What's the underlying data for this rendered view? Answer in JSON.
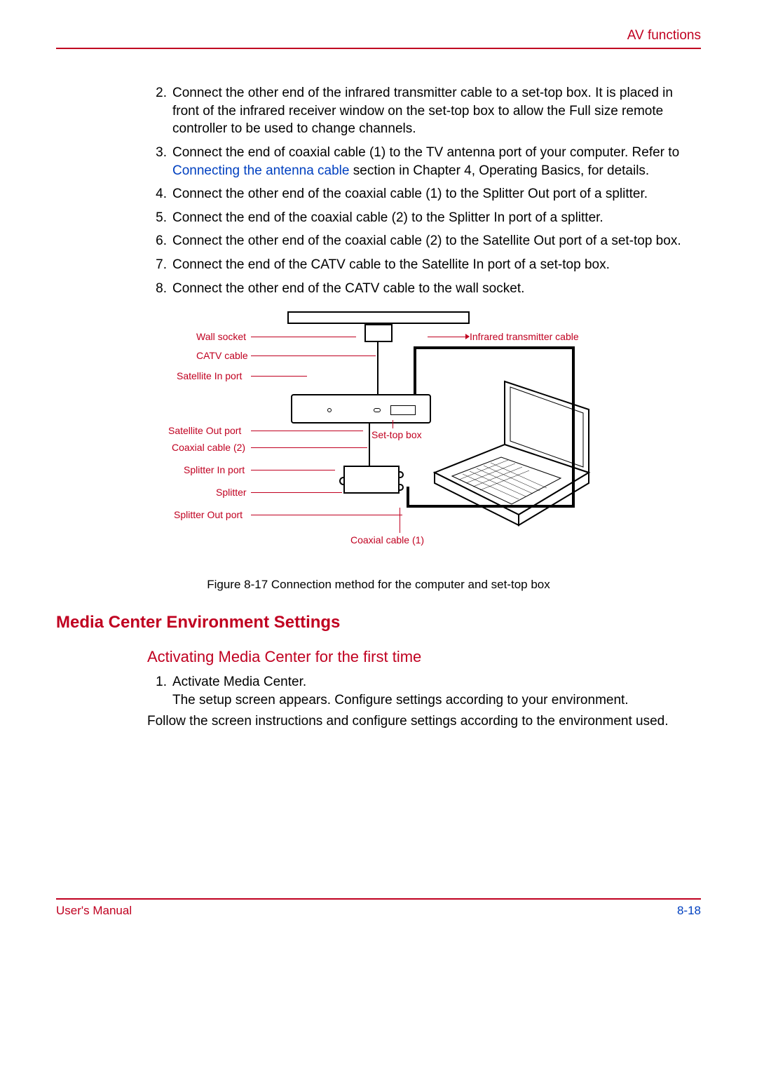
{
  "header": {
    "title": "AV functions"
  },
  "steps": [
    {
      "n": "2.",
      "text": "Connect the other end of the infrared transmitter cable to a set-top box. It is placed in front of the infrared receiver window on the set-top box to allow the Full size remote controller to be used to change channels."
    },
    {
      "n": "3.",
      "pre": "Connect the end of coaxial cable (1) to the TV antenna port of your computer. Refer to ",
      "link": "Connecting the antenna cable",
      "post": " section in Chapter 4, Operating Basics, for details."
    },
    {
      "n": "4.",
      "text": "Connect the other end of the coaxial cable (1) to the Splitter Out port of a splitter."
    },
    {
      "n": "5.",
      "text": "Connect the end of the coaxial cable (2) to the Splitter In port of a splitter."
    },
    {
      "n": "6.",
      "text": "Connect the other end of the coaxial cable (2) to the Satellite Out port of a set-top box."
    },
    {
      "n": "7.",
      "text": "Connect the end of the CATV cable to the Satellite In port of a set-top box."
    },
    {
      "n": "8.",
      "text": "Connect the other end of the CATV cable to the wall socket."
    }
  ],
  "labels": {
    "wall_socket": "Wall socket",
    "catv_cable": "CATV cable",
    "sat_in": "Satellite In port",
    "sat_out": "Satellite Out port",
    "coax2": "Coaxial cable (2)",
    "splitter_in": "Splitter In port",
    "splitter": "Splitter",
    "splitter_out": "Splitter Out port",
    "coax1": "Coaxial cable (1)",
    "ir_cable": "Infrared transmitter cable",
    "settop": "Set-top box"
  },
  "figure_caption": "Figure 8-17 Connection method for the computer and set-top box",
  "section_heading": "Media Center Environment Settings",
  "sub_heading": "Activating Media Center for the first time",
  "activate": [
    {
      "n": "1.",
      "text": "Activate Media Center.",
      "sub": "The setup screen appears. Configure settings according to your environment."
    }
  ],
  "follow_para": "Follow the screen instructions and configure settings according to the environment used.",
  "footer": {
    "left": "User's Manual",
    "right": "8-18"
  }
}
